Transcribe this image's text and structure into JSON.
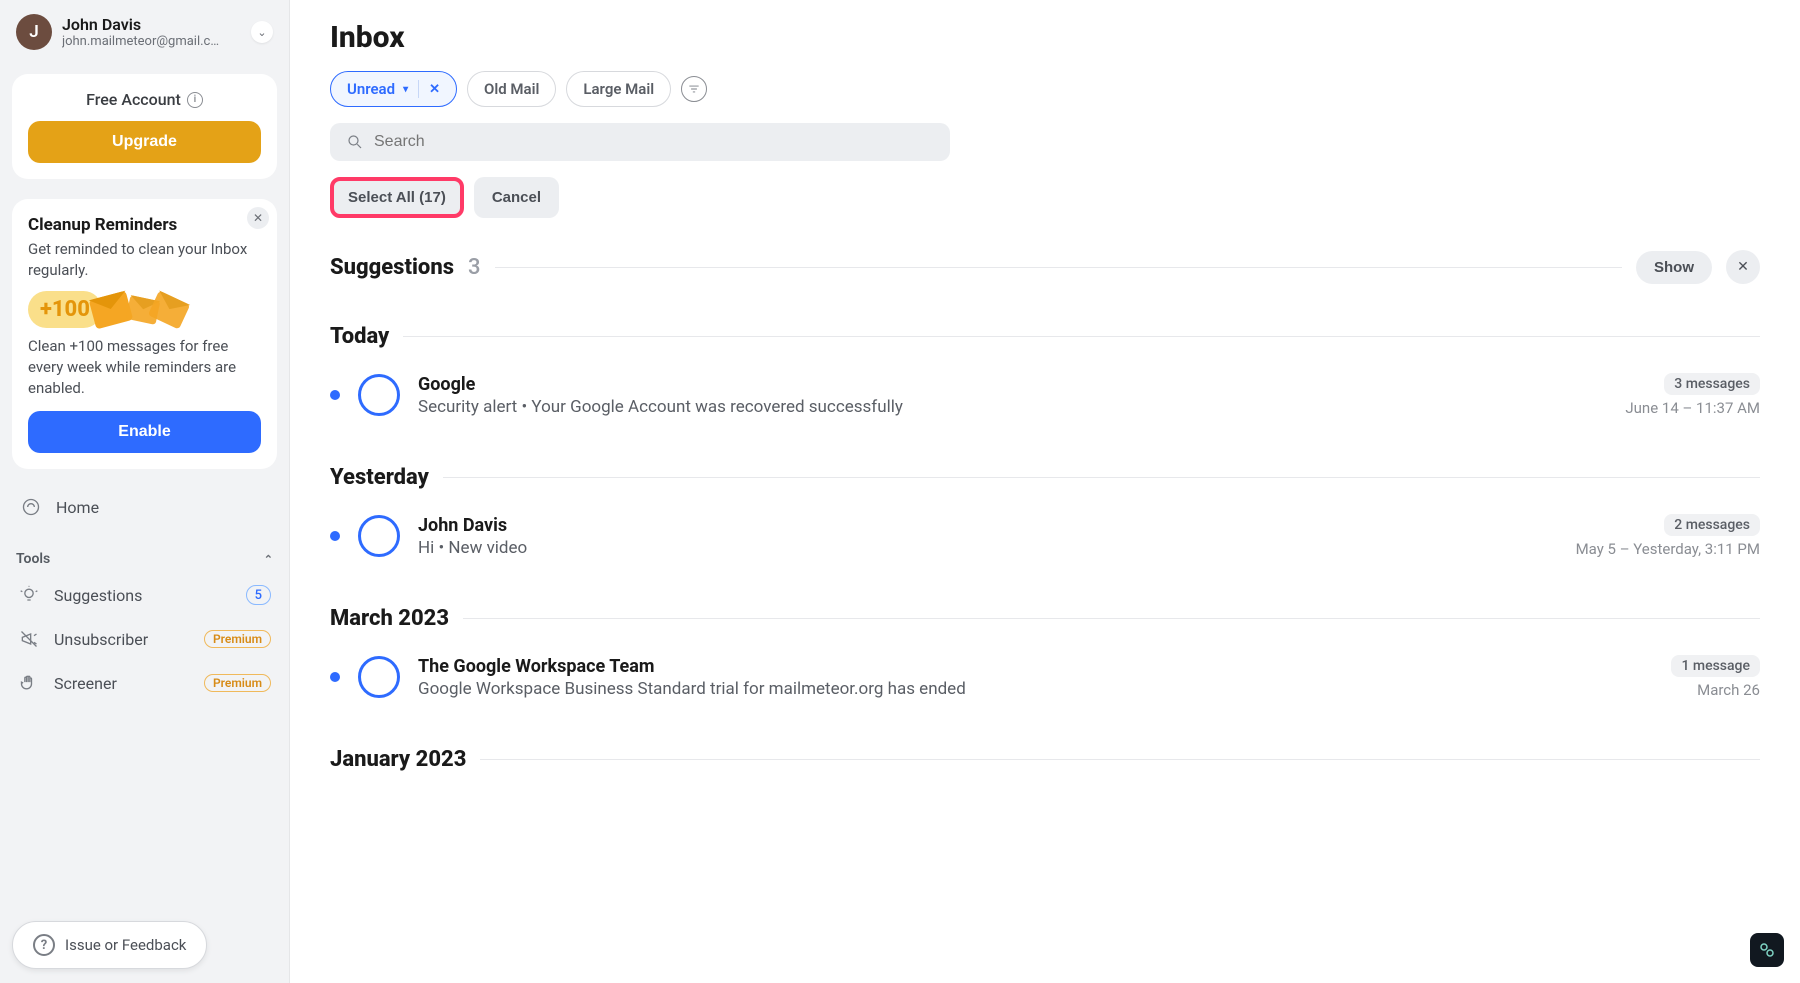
{
  "user": {
    "initial": "J",
    "name": "John Davis",
    "email": "john.mailmeteor@gmail.c…"
  },
  "account_card": {
    "tier": "Free Account",
    "upgrade_label": "Upgrade"
  },
  "reminder": {
    "title": "Cleanup Reminders",
    "subtitle": "Get reminded to clean your Inbox regularly.",
    "promo_badge": "+100",
    "description": "Clean +100 messages for free every week while reminders are enabled.",
    "enable_label": "Enable"
  },
  "nav": {
    "home": "Home",
    "tools_header": "Tools",
    "suggestions": "Suggestions",
    "suggestions_count": "5",
    "unsubscriber": "Unsubscriber",
    "screener": "Screener",
    "premium_badge": "Premium"
  },
  "feedback_label": "Issue or Feedback",
  "inbox": {
    "title": "Inbox",
    "filters": {
      "unread": "Unread",
      "old": "Old Mail",
      "large": "Large Mail"
    },
    "search_placeholder": "Search",
    "select_all": "Select All (17)",
    "cancel": "Cancel"
  },
  "sections": {
    "suggestions": {
      "label": "Suggestions",
      "count": "3",
      "show": "Show"
    },
    "today": "Today",
    "yesterday": "Yesterday",
    "march": "March 2023",
    "january": "January 2023"
  },
  "messages": {
    "today": {
      "sender": "Google",
      "preview": "Security alert • Your Google Account was recovered successfully",
      "count": "3 messages",
      "time": "June 14 – 11:37 AM"
    },
    "yesterday": {
      "sender": "John Davis",
      "preview": "Hi • New video",
      "count": "2 messages",
      "time": "May 5 – Yesterday, 3:11 PM"
    },
    "march": {
      "sender": "The Google Workspace Team",
      "preview": "Google Workspace Business Standard trial for mailmeteor.org has ended",
      "count": "1 message",
      "time": "March 26"
    }
  }
}
